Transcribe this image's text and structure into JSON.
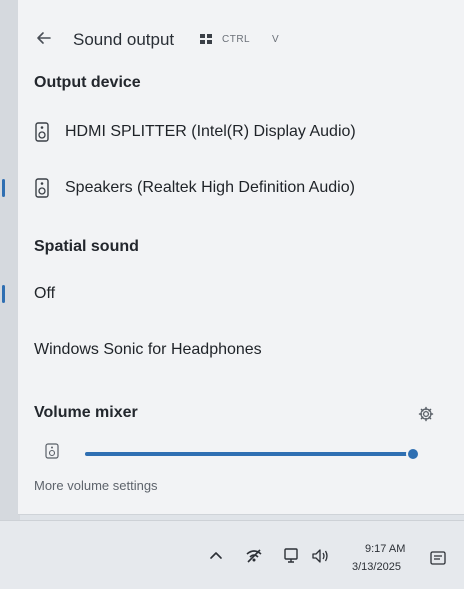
{
  "header": {
    "title": "Sound output",
    "shortcut_label": "CTRL",
    "shortcut_key": "V"
  },
  "output_device": {
    "heading": "Output device",
    "items": [
      {
        "label": "HDMI SPLITTER (Intel(R) Display Audio)",
        "selected": false,
        "icon": "speaker-icon"
      },
      {
        "label": "Speakers (Realtek High Definition Audio)",
        "selected": true,
        "icon": "speaker-icon"
      }
    ]
  },
  "spatial_sound": {
    "heading": "Spatial sound",
    "items": [
      {
        "label": "Off",
        "selected": true
      },
      {
        "label": "Windows Sonic for Headphones",
        "selected": false
      }
    ]
  },
  "volume_mixer": {
    "heading": "Volume mixer",
    "level": 1.0,
    "more_settings": "More volume settings"
  },
  "taskbar": {
    "time": "9:17 AM",
    "date": "3/13/2025"
  },
  "colors": {
    "accent": "#2f6fb2",
    "panel_bg": "#f2f3f5"
  }
}
